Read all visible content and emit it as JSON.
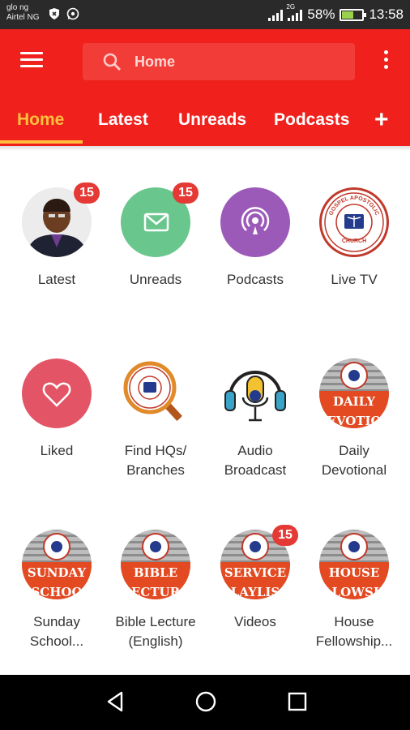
{
  "status_bar": {
    "carrier1": "glo ng",
    "carrier2": "Airtel NG",
    "network": "2G",
    "battery": "58%",
    "battery_level": 0.58,
    "time": "13:58"
  },
  "app_bar": {
    "search_text": "Home",
    "accent": "#f0211c"
  },
  "tabs": [
    {
      "label": "Home",
      "active": true
    },
    {
      "label": "Latest"
    },
    {
      "label": "Unreads"
    },
    {
      "label": "Podcasts"
    }
  ],
  "tab_add_label": "+",
  "tiles": [
    {
      "label": "Latest",
      "badge": "15",
      "icon": "profile-photo"
    },
    {
      "label": "Unreads",
      "badge": "15",
      "icon": "envelope-icon"
    },
    {
      "label": "Podcasts",
      "icon": "podcast-icon"
    },
    {
      "label": "Live TV",
      "icon": "church-seal-logo",
      "seal_top": "GOSPEL APOSTOLIC",
      "seal_bottom": "CHURCH"
    },
    {
      "label": "Liked",
      "icon": "heart-icon"
    },
    {
      "label_line1": "Find HQs/",
      "label_line2": "Branches",
      "icon": "magnifier-seal-icon"
    },
    {
      "label_line1": "Audio",
      "label_line2": "Broadcast",
      "icon": "headphone-mic-icon"
    },
    {
      "label_line1": "Daily",
      "label_line2": "Devotional",
      "icon": "daily-devotional-thumb",
      "banner1": "DAILY",
      "banner2": "EVOTIO"
    },
    {
      "label_line1": "Sunday",
      "label_line2": "School...",
      "icon": "sunday-school-thumb",
      "banner1": "SUNDAY",
      "banner2": "SCHOO"
    },
    {
      "label_line1": "Bible Lecture",
      "label_line2": "(English)",
      "icon": "bible-lecture-thumb",
      "banner1": "BIBLE",
      "banner2": "ECTUR"
    },
    {
      "label": "Videos",
      "badge": "15",
      "icon": "service-playlist-thumb",
      "banner1": "SERVICE",
      "banner2": "LAYLIS"
    },
    {
      "label_line1": "House",
      "label_line2": "Fellowship...",
      "icon": "house-fellowship-thumb",
      "banner1": "HOUSE",
      "banner2": "LLOWSH"
    }
  ],
  "nav_bar": {
    "icons": [
      "back-icon",
      "home-circle-icon",
      "recents-square-icon"
    ]
  }
}
